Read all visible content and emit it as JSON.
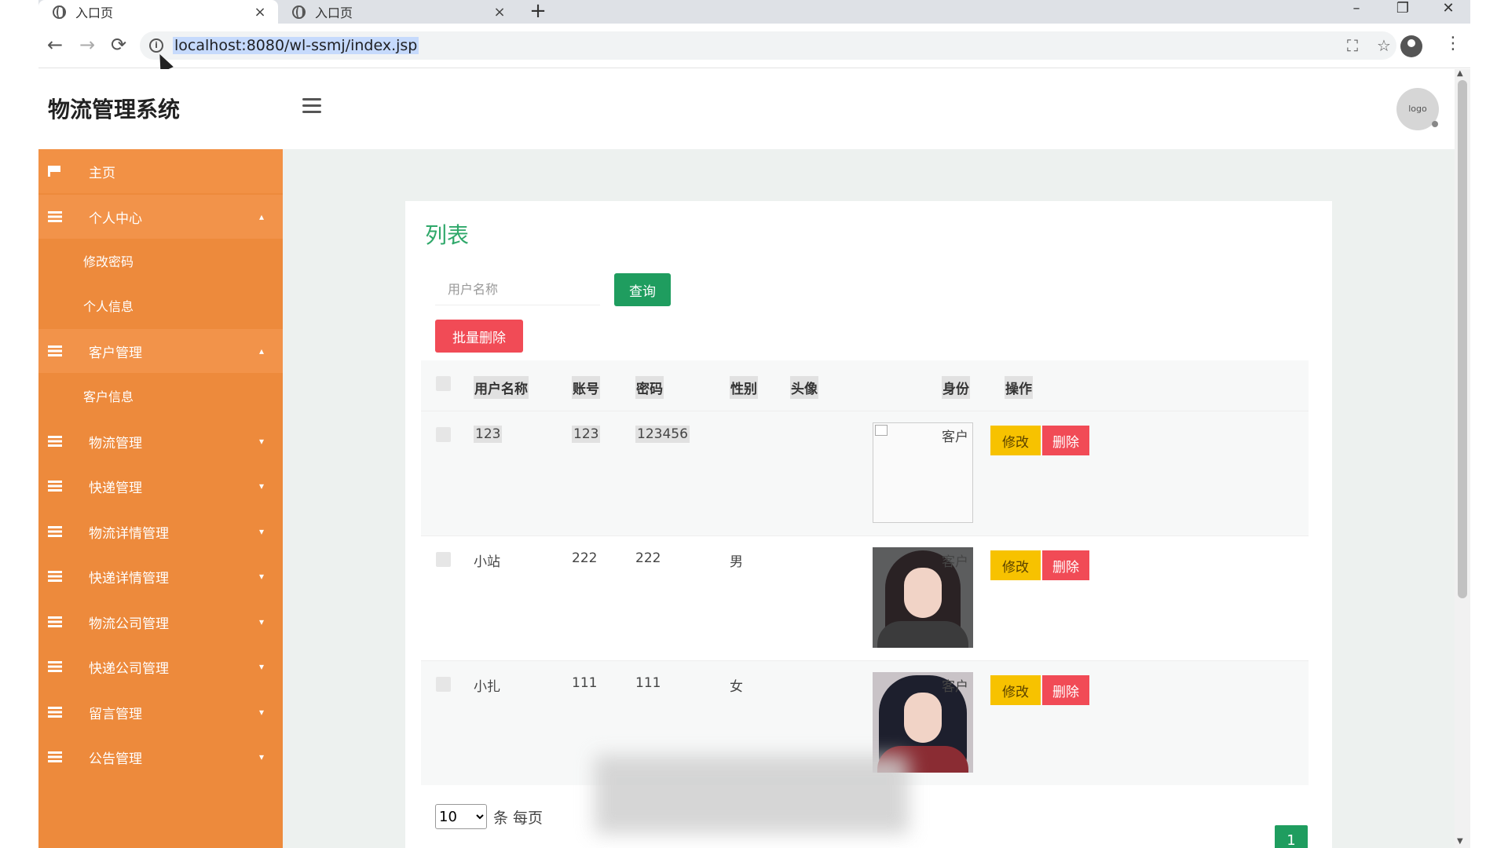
{
  "browser": {
    "tabs": [
      {
        "title": "入口页",
        "close": "×",
        "active": true
      },
      {
        "title": "入口页",
        "close": "×",
        "active": false
      }
    ],
    "new_tab": "+",
    "window_controls": {
      "minimize": "–",
      "restore": "❐",
      "close": "✕"
    },
    "nav": {
      "back": "←",
      "forward": "→",
      "reload": "⟳"
    },
    "url": "localhost:8080/wl-ssmj/index.jsp",
    "info": "i",
    "extension_icon": "⛶",
    "bookmark_star": "☆",
    "menu": "⋮"
  },
  "app": {
    "title": "物流管理系统",
    "avatar_text": "logo"
  },
  "sidebar": {
    "items": [
      {
        "label": "主页",
        "icon": "flag-icon"
      },
      {
        "label": "个人中心",
        "icon": "grid-icon",
        "caret": "▴",
        "children": [
          "修改密码",
          "个人信息"
        ]
      },
      {
        "label": "客户管理",
        "icon": "grid-icon",
        "caret": "▴",
        "children": [
          "客户信息"
        ]
      },
      {
        "label": "物流管理",
        "icon": "grid-icon",
        "caret": "▾"
      },
      {
        "label": "快递管理",
        "icon": "grid-icon",
        "caret": "▾"
      },
      {
        "label": "物流详情管理",
        "icon": "grid-icon",
        "caret": "▾"
      },
      {
        "label": "快递详情管理",
        "icon": "grid-icon",
        "caret": "▾"
      },
      {
        "label": "物流公司管理",
        "icon": "grid-icon",
        "caret": "▾"
      },
      {
        "label": "快递公司管理",
        "icon": "grid-icon",
        "caret": "▾"
      },
      {
        "label": "留言管理",
        "icon": "grid-icon",
        "caret": "▾"
      },
      {
        "label": "公告管理",
        "icon": "grid-icon",
        "caret": "▾"
      }
    ]
  },
  "main": {
    "title": "列表",
    "search": {
      "placeholder": "用户名称",
      "value": ""
    },
    "query_label": "查询",
    "bulk_delete_label": "批量删除",
    "table": {
      "headers": [
        "用户名称",
        "账号",
        "密码",
        "性别",
        "头像",
        "身份",
        "操作"
      ],
      "rows": [
        {
          "name": "123",
          "account": "123",
          "password": "123456",
          "gender": "",
          "avatar": "broken-image",
          "role": "客户",
          "edit": "修改",
          "delete": "删除"
        },
        {
          "name": "小站",
          "account": "222",
          "password": "222",
          "gender": "男",
          "avatar": "photo",
          "role": "客户",
          "edit": "修改",
          "delete": "删除"
        },
        {
          "name": "小扎",
          "account": "111",
          "password": "111",
          "gender": "女",
          "avatar": "photo",
          "role": "客户",
          "edit": "修改",
          "delete": "删除"
        }
      ]
    },
    "pagination": {
      "page_size": "10",
      "page_size_options": [
        "10"
      ],
      "per_page_label": "条 每页",
      "current_page": "1"
    }
  },
  "colors": {
    "sidebar": "#ed8a3c",
    "title_green": "#2fa86a",
    "query_green": "#1f9d5f",
    "delete_red": "#f14b56",
    "edit_yellow": "#f7c200"
  }
}
